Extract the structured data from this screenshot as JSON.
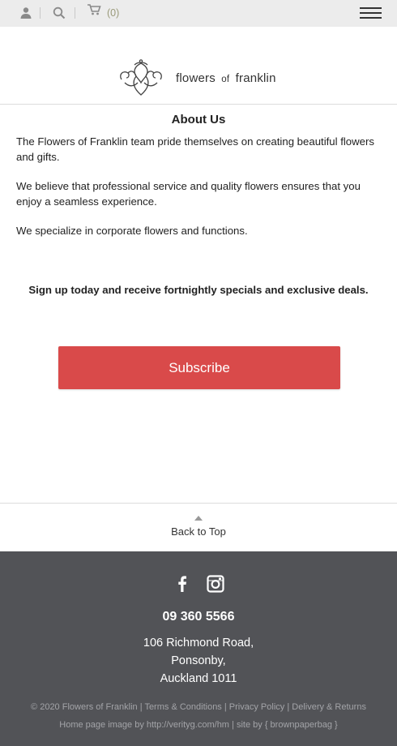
{
  "topbar": {
    "icons": [
      "user-icon",
      "search-icon",
      "cart-icon",
      "menu-icon"
    ],
    "cart_count": "(0)"
  },
  "logo": {
    "word1": "flowers",
    "word2": "of",
    "word3": "franklin"
  },
  "about": {
    "title": "About Us",
    "para1": "The Flowers of Franklin team pride themselves on creating beautiful flowers and gifts.",
    "para2": "We believe that professional service and quality flowers ensures that you enjoy a seamless experience.",
    "para3": "We specialize in corporate flowers and functions."
  },
  "signup": {
    "text": "Sign up today and receive fortnightly specials and exclusive deals.",
    "button_label": "Subscribe"
  },
  "back_to_top": "Back to Top",
  "footer": {
    "social_icons": [
      "facebook-icon",
      "instagram-icon"
    ],
    "phone": "09 360 5566",
    "address_line1": "106 Richmond Road,",
    "address_line2": "Ponsonby,",
    "address_line3": "Auckland 1011",
    "copyright": "© 2020 Flowers of Franklin",
    "terms": "Terms & Conditions",
    "privacy": "Privacy Policy",
    "delivery": "Delivery & Returns",
    "image_credit": "Home page image by http://verityg.com/hm",
    "site_credit": "site by { brownpaperbag }",
    "separator": "|"
  },
  "colors": {
    "accent": "#d94a4a",
    "footer_bg": "#525357",
    "topbar_bg": "#ececec"
  }
}
